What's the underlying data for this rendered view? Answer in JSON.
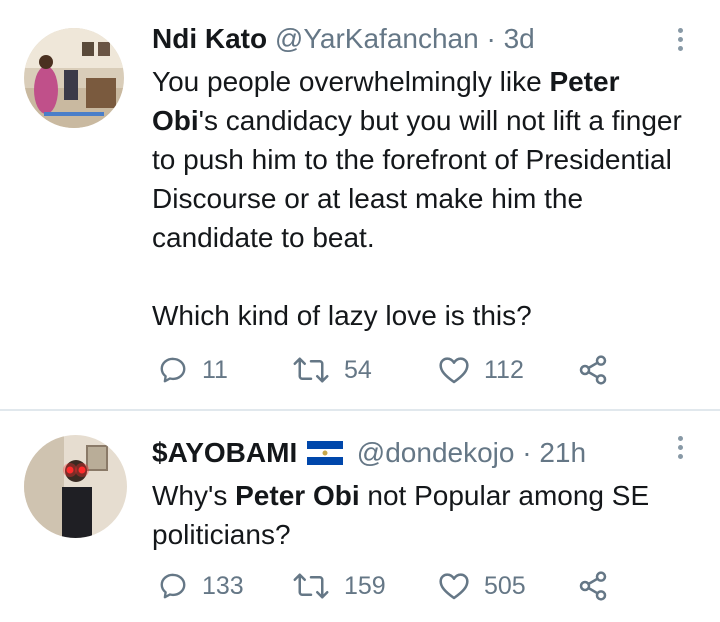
{
  "tweets": [
    {
      "display_name": "Ndi Kato",
      "handle": "@YarKafanchan",
      "separator": "·",
      "time": "3d",
      "text_part1": "You people overwhelmingly like ",
      "text_bold": "Peter Obi",
      "text_part2": "'s candidacy but you will not lift a finger to push him to the forefront of Presidential Discourse or at least make him the candidate to beat.",
      "text_para2": "Which kind of lazy love is this?",
      "replies": "11",
      "retweets": "54",
      "likes": "112"
    },
    {
      "display_name": "$AYOBAMI",
      "handle": "@dondekojo",
      "separator": "·",
      "time": "21h",
      "text_part1": "Why's ",
      "text_bold": "Peter Obi",
      "text_part2": " not Popular among SE politicians?",
      "replies": "133",
      "retweets": "159",
      "likes": "505"
    }
  ],
  "icons": {
    "reply": "reply-icon",
    "retweet": "retweet-icon",
    "like": "heart-icon",
    "share": "share-icon",
    "more": "more-vertical-icon",
    "flag": "el-salvador-flag-icon"
  },
  "colors": {
    "text": "#14171a",
    "secondary": "#657786",
    "divider": "#e1e8ed"
  }
}
